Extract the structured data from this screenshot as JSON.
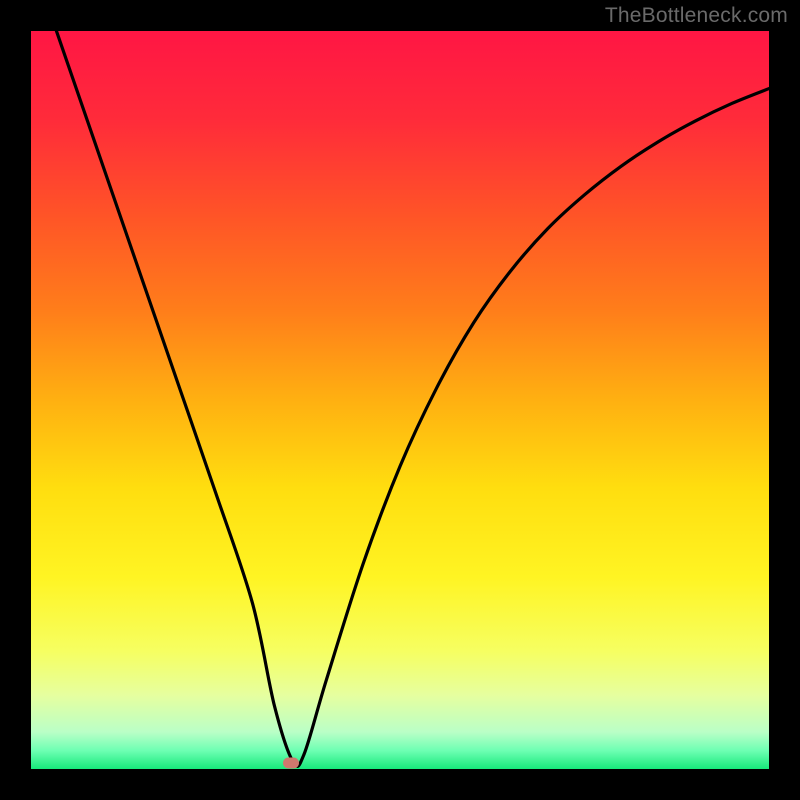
{
  "watermark": "TheBottleneck.com",
  "colors": {
    "frame": "#000000",
    "curve": "#000000",
    "marker": "#cf786e",
    "gradient_stops": [
      {
        "offset": 0.0,
        "color": "#ff1644"
      },
      {
        "offset": 0.12,
        "color": "#ff2b3a"
      },
      {
        "offset": 0.25,
        "color": "#ff5427"
      },
      {
        "offset": 0.38,
        "color": "#ff7e1a"
      },
      {
        "offset": 0.5,
        "color": "#ffb011"
      },
      {
        "offset": 0.62,
        "color": "#ffde0f"
      },
      {
        "offset": 0.74,
        "color": "#fff423"
      },
      {
        "offset": 0.84,
        "color": "#f6ff61"
      },
      {
        "offset": 0.9,
        "color": "#e6ff9f"
      },
      {
        "offset": 0.95,
        "color": "#baffc7"
      },
      {
        "offset": 0.975,
        "color": "#6effb3"
      },
      {
        "offset": 1.0,
        "color": "#17e97a"
      }
    ]
  },
  "chart_data": {
    "type": "line",
    "title": "",
    "xlabel": "",
    "ylabel": "",
    "xlim": [
      0,
      1
    ],
    "ylim": [
      0,
      1
    ],
    "series": [
      {
        "name": "bottleneck-curve",
        "x": [
          0.0,
          0.05,
          0.1,
          0.15,
          0.2,
          0.25,
          0.3,
          0.33,
          0.355,
          0.37,
          0.4,
          0.45,
          0.5,
          0.55,
          0.6,
          0.65,
          0.7,
          0.75,
          0.8,
          0.85,
          0.9,
          0.95,
          1.0
        ],
        "y": [
          1.1,
          0.955,
          0.81,
          0.665,
          0.52,
          0.375,
          0.225,
          0.085,
          0.01,
          0.02,
          0.12,
          0.278,
          0.41,
          0.517,
          0.605,
          0.675,
          0.732,
          0.778,
          0.817,
          0.85,
          0.878,
          0.902,
          0.922
        ]
      }
    ],
    "marker": {
      "x": 0.352,
      "y": 0.008
    },
    "notes": "y normalized 0..1 bottom-to-top; values read off pixel positions relative to 738px plot box"
  }
}
